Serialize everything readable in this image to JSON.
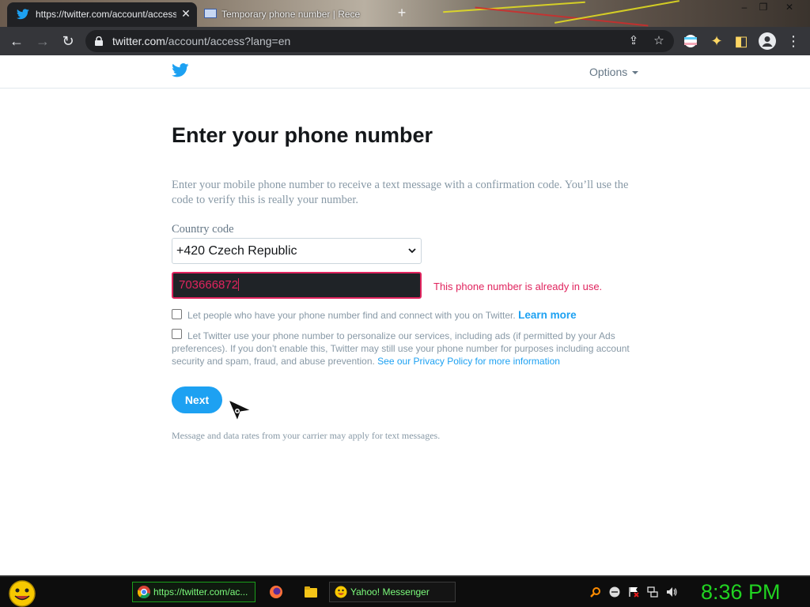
{
  "browser": {
    "active_tab": {
      "title": "https://twitter.com/account/access",
      "favicon": "twitter-bird-icon"
    },
    "inactive_tab": {
      "title": "Temporary phone number | Rece",
      "favicon": "mail-icon"
    },
    "url_host": "twitter.com",
    "url_path": "/account/access?lang=en"
  },
  "header": {
    "logo": "twitter-bird-icon",
    "options_label": "Options"
  },
  "main": {
    "title": "Enter your phone number",
    "intro": "Enter your mobile phone number to receive a text message with a confirmation code. You’ll use the code to verify this is really your number.",
    "country_label": "Country code",
    "country_value": "+420 Czech Republic",
    "phone_value": "703666872",
    "error": "This phone number is already in use.",
    "discover_text": "Let people who have your phone number find and connect with you on Twitter.",
    "discover_link": "Learn more",
    "ads_text": "Let Twitter use your phone number to personalize our services, including ads (if permitted by your Ads preferences). If you don’t enable this, Twitter may still use your phone number for purposes including account security and spam, fraud, and abuse prevention.",
    "ads_link": "See our Privacy Policy for more information",
    "next_label": "Next",
    "disclaimer": "Message and data rates from your carrier may apply for text messages."
  },
  "taskbar": {
    "tasks": [
      {
        "label": "https://twitter.com/ac...",
        "icon": "chrome-icon"
      },
      {
        "label": "Yahoo! Messenger",
        "icon": "smiley-icon"
      }
    ],
    "clock": "8:36 PM"
  },
  "colors": {
    "twitter_blue": "#1da1f2",
    "error_red": "#e0245e",
    "clock_green": "#21d321"
  }
}
